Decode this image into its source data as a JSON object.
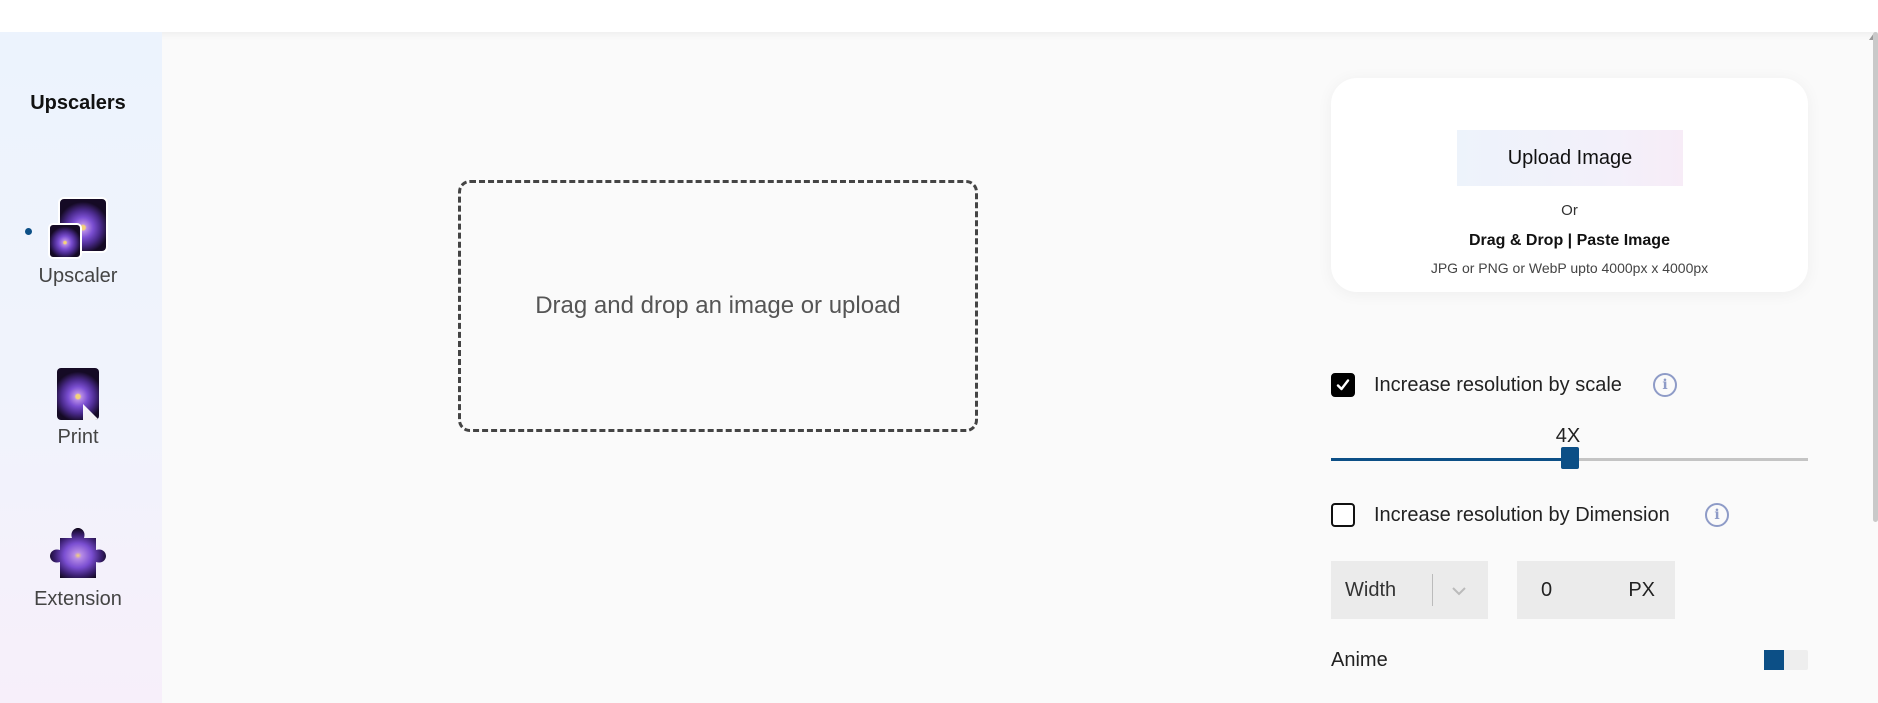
{
  "sidebar": {
    "title": "Upscalers",
    "items": [
      {
        "label": "Upscaler",
        "icon": "upscaler-icon",
        "active": true
      },
      {
        "label": "Print",
        "icon": "print-icon",
        "active": false
      },
      {
        "label": "Extension",
        "icon": "extension-icon",
        "active": false
      }
    ]
  },
  "main": {
    "dropzone_text": "Drag and drop an image or upload"
  },
  "upload_panel": {
    "button_label": "Upload Image",
    "or_text": "Or",
    "drag_drop_text": "Drag & Drop | Paste Image",
    "hint": "JPG or PNG or WebP upto 4000px x 4000px"
  },
  "options": {
    "scale": {
      "label": "Increase resolution by scale",
      "checked": true,
      "value_label": "4X",
      "slider_fraction": 0.5
    },
    "dimension": {
      "label": "Increase resolution by Dimension",
      "checked": false,
      "select_value": "Width",
      "value": "0",
      "unit": "PX"
    },
    "anime": {
      "label": "Anime",
      "enabled": false
    }
  },
  "colors": {
    "accent": "#0c4f86",
    "checkbox_checked": "#000000"
  }
}
